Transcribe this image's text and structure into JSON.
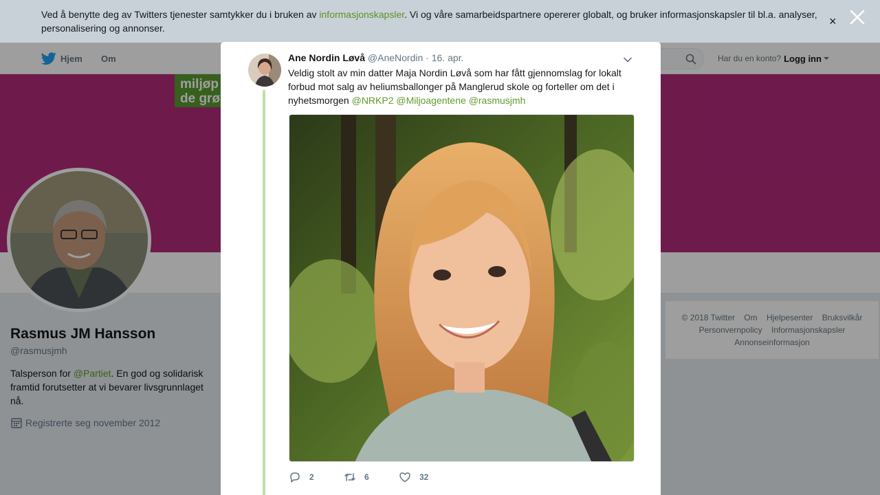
{
  "cookie_bar": {
    "text_before": "Ved å benytte deg av Twitters tjenester samtykker du i bruken av ",
    "link": "informasjonskapsler",
    "text_after": ". Vi og våre samarbeidspartnere opererer globalt, og bruker informasjonskapsler til bl.a. analyser, personalisering og annonser.",
    "close_label": "×"
  },
  "topnav": {
    "home": "Hjem",
    "about": "Om",
    "account_prompt": "Har du en konto?",
    "login": "Logg inn"
  },
  "banner": {
    "logo_line1": "miljøp",
    "logo_line2": "de grø"
  },
  "profile": {
    "name": "Rasmus JM Hansson",
    "handle": "@rasmusjmh",
    "bio_before": "Talsperson for ",
    "bio_link": "@Partiet",
    "bio_after": ". En god og solidarisk framtid forutsetter at vi bevarer livsgrunnlaget nå.",
    "joined": "Registrerte seg november 2012"
  },
  "footer": {
    "links": [
      "© 2018 Twitter",
      "Om",
      "Hjelpesenter",
      "Bruksvilkår",
      "Personvernpolicy",
      "Informasjonskapsler",
      "Annonseinformasjon"
    ]
  },
  "tweet": {
    "fullname": "Ane Nordin Løvå",
    "handle": "@AneNordin",
    "separator": "·",
    "time": "16. apr.",
    "text": "Veldig stolt av min datter Maja Nordin Løvå som har fått gjennomslag for lokalt forbud mot salg av heliumsballonger på Manglerud skole og forteller om det i nyhetsmorgen ",
    "mentions": [
      "@NRKP2",
      "@Miljoagentene",
      "@rasmusjmh"
    ],
    "replies": "2",
    "retweets": "6",
    "likes": "32"
  },
  "colors": {
    "accent": "#629a2c",
    "banner": "#b22a7a",
    "logo_green": "#5a9a2f",
    "thread": "#c2e0a5"
  }
}
